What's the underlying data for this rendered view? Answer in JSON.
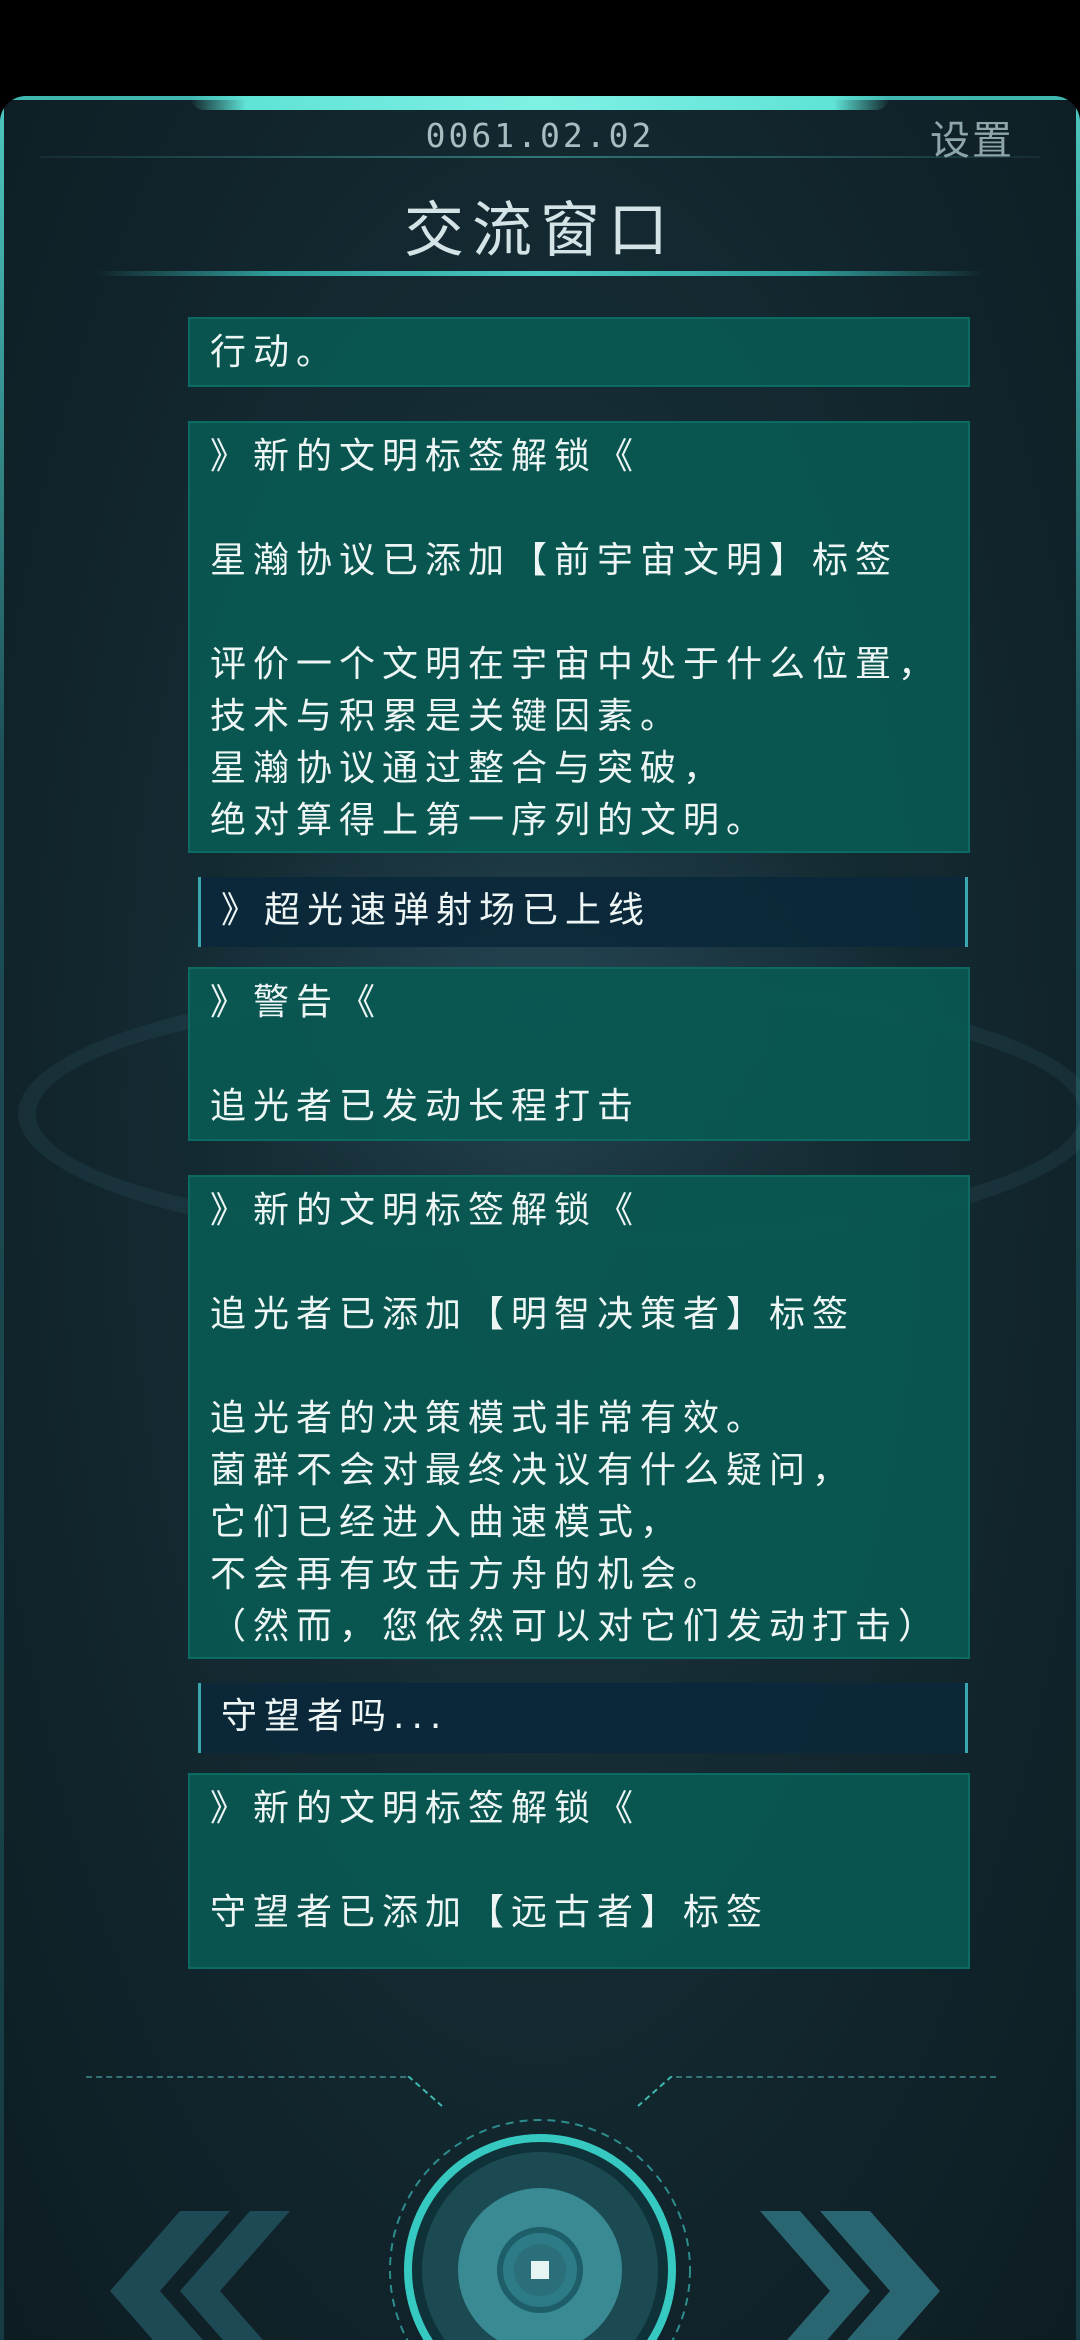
{
  "header": {
    "date": "0061.02.02",
    "settings_label": "设置",
    "title": "交流窗口"
  },
  "messages": [
    {
      "style": "teal",
      "text": "行动。"
    },
    {
      "style": "teal",
      "text": "》新的文明标签解锁《\n\n星瀚协议已添加【前宇宙文明】标签\n\n评价一个文明在宇宙中处于什么位置，\n技术与积累是关键因素。\n星瀚协议通过整合与突破，\n绝对算得上第一序列的文明。"
    },
    {
      "style": "dark",
      "text": "》超光速弹射场已上线"
    },
    {
      "style": "teal",
      "text": "》警告《\n\n追光者已发动长程打击"
    },
    {
      "style": "teal",
      "text": "》新的文明标签解锁《\n\n追光者已添加【明智决策者】标签\n\n追光者的决策模式非常有效。\n菌群不会对最终决议有什么疑问，\n它们已经进入曲速模式，\n不会再有攻击方舟的机会。\n（然而，您依然可以对它们发动打击）"
    },
    {
      "style": "dark",
      "text": "守望者吗..."
    },
    {
      "style": "teal",
      "text": "》新的文明标签解锁《\n\n守望者已添加【远古者】标签"
    }
  ],
  "controls": {
    "prev_icon": "double-chevron-left-icon",
    "next_icon": "double-chevron-right-icon",
    "center_icon": "stop-square-icon"
  },
  "colors": {
    "message_teal": "#095852",
    "message_dark": "#0a283a",
    "accent": "#3fc7c0",
    "text": "#eef6f5"
  }
}
